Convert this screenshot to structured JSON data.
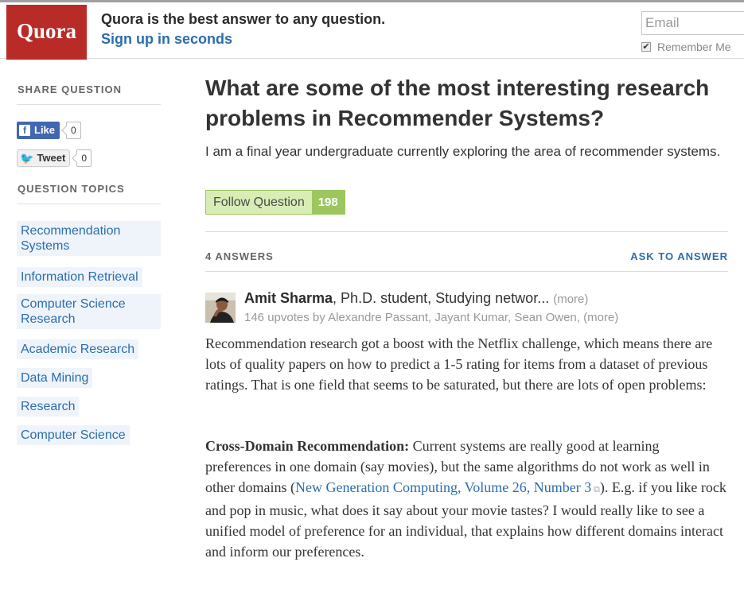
{
  "header": {
    "logo": "Quora",
    "tagline": "Quora is the best answer to any question.",
    "signup": "Sign up in seconds",
    "email_placeholder": "Email",
    "remember_me": "Remember Me",
    "remember_checked": true
  },
  "sidebar": {
    "share_heading": "SHARE QUESTION",
    "like_label": "Like",
    "like_count": "0",
    "tweet_label": "Tweet",
    "tweet_count": "0",
    "topics_heading": "QUESTION TOPICS",
    "topics": [
      "Recommendation Systems",
      "Information Retrieval",
      "Computer Science Research",
      "Academic Research",
      "Data Mining",
      "Research",
      "Computer Science"
    ]
  },
  "question": {
    "title": "What are some of the most interesting research problems in Recommender Systems?",
    "detail": "I am a final year undergraduate currently exploring the area of recommender systems.",
    "follow_label": "Follow Question",
    "follow_count": "198"
  },
  "answers": {
    "count_label": "4 ANSWERS",
    "ask_label": "ASK TO ANSWER",
    "first": {
      "author": "Amit Sharma",
      "credential": ", Ph.D. student, Studying networ...",
      "more": "(more)",
      "upvotes": "146 upvotes by Alexandre Passant, Jayant Kumar, Sean Owen,",
      "upvotes_more": "(more)",
      "para1": "Recommendation research got a boost with the Netflix challenge, which means there are lots of quality papers on how to predict a 1-5 rating for items from a dataset of previous ratings. That is one field that seems to be saturated, but there are lots of open problems:",
      "para2_heading": "Cross-Domain Recommendation:",
      "para2_text_a": " Current systems are really good at learning preferences in one domain (say movies), but the same algorithms do not work as well in other domains (",
      "para2_link": "New Generation Computing, Volume 26, Number 3",
      "para2_text_b": "). E.g. if you like rock and pop in music, what does it say about your movie tastes? I would really like to see a unified model of preference for an individual, that explains how different domains interact and inform our preferences."
    }
  }
}
